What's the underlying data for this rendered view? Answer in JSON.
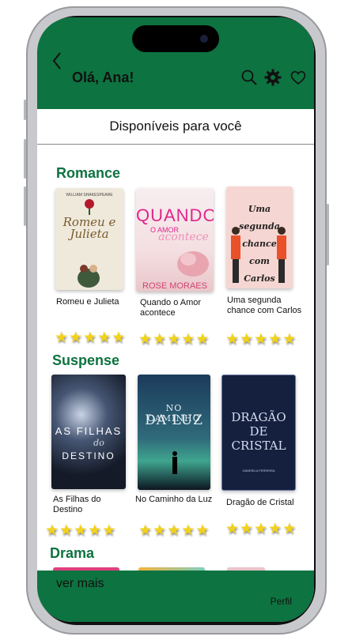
{
  "header": {
    "greeting": "Olá, Ana!"
  },
  "subheader": {
    "title": "Disponíveis para você"
  },
  "sections": [
    {
      "title": "Romance",
      "books": [
        {
          "title": "Romeu e Julieta",
          "cover_top": "WILLIAM SHAKESPEARE",
          "cover_main": "Romeu e Julieta",
          "rating": 5
        },
        {
          "title": "Quando o Amor acontece",
          "cover_main": "QUANDO",
          "cover_sub": "O AMOR",
          "cover_script": "acontece",
          "cover_author": "ROSE MORAES",
          "rating": 5
        },
        {
          "title": "Uma segunda chance com  Carlos",
          "cover_main": "Uma segunda chance com Carlos",
          "rating": 5
        }
      ]
    },
    {
      "title": "Suspense",
      "books": [
        {
          "title": "As Filhas do Destino",
          "cover_main": "AS FILHAS",
          "cover_sub": "do",
          "cover_bottom": "DESTINO",
          "rating": 5
        },
        {
          "title": "No Caminho da Luz",
          "cover_main": "NO CAMINHO",
          "cover_sub": "DA LUZ",
          "rating": 5
        },
        {
          "title": "Dragão de Cristal",
          "cover_main": "DRAGÃO DE CRISTAL",
          "cover_author": "GABRIELA FERREIRA",
          "rating": 5
        }
      ]
    },
    {
      "title": "Drama"
    }
  ],
  "footer": {
    "more": "ver mais",
    "profile": "Perfil"
  },
  "colors": {
    "brand": "#0d7340",
    "star": "#f2d21a"
  },
  "icons": [
    "chevron-left-icon",
    "search-icon",
    "gear-icon",
    "heart-icon",
    "star-icon"
  ]
}
